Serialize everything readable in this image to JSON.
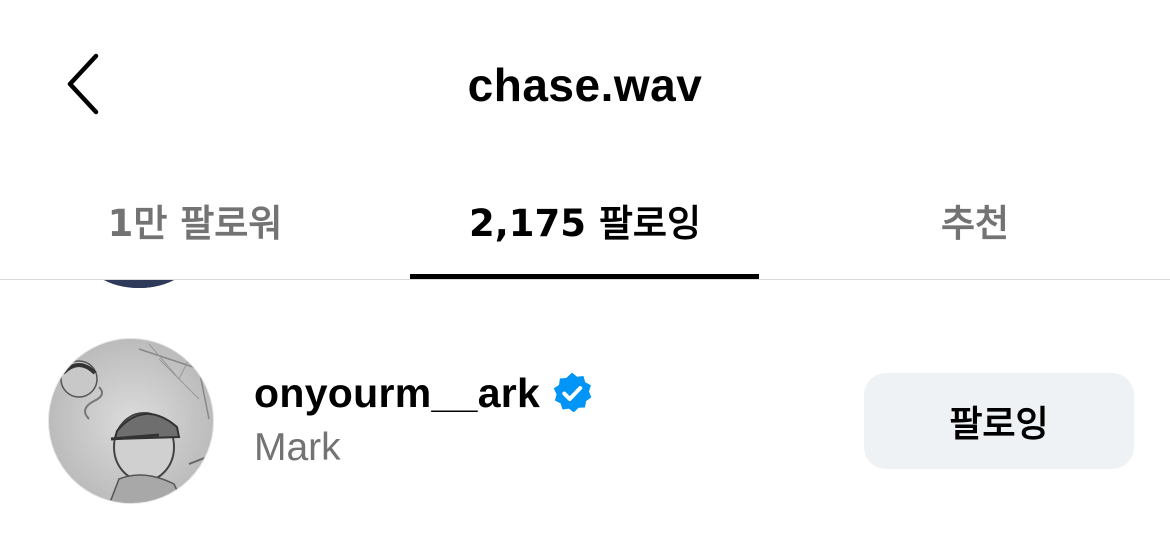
{
  "header": {
    "title": "chase.wav",
    "back_icon": "chevron-left-icon"
  },
  "tabs": [
    {
      "label": "1만 팔로워",
      "active": false
    },
    {
      "label": "2,175 팔로잉",
      "active": true
    },
    {
      "label": "추천",
      "active": false
    }
  ],
  "list": {
    "items": [
      {
        "username": "onyourm__ark",
        "verified": true,
        "full_name": "Mark",
        "button_label": "팔로잉",
        "avatar": "avatar-sketch"
      }
    ]
  },
  "colors": {
    "text_primary": "#000000",
    "text_secondary": "#737373",
    "verified_blue": "#0095f6",
    "button_bg": "#eff2f5",
    "divider": "#dbdbdb"
  }
}
